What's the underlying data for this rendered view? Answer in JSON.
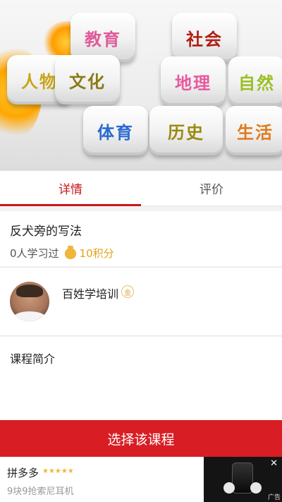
{
  "hero": {
    "tiles": [
      "教育",
      "社会",
      "人物",
      "文化",
      "地理",
      "自然",
      "体育",
      "历史",
      "生活"
    ]
  },
  "tabs": [
    {
      "label": "详情",
      "active": true
    },
    {
      "label": "评价",
      "active": false
    }
  ],
  "course": {
    "title": "反犬旁的写法",
    "learners": "0人学习过",
    "points": "10积分"
  },
  "teacher": {
    "name": "百姓学培训",
    "badge": "金"
  },
  "intro": {
    "label": "课程简介"
  },
  "cta": {
    "label": "选择该课程"
  },
  "ad": {
    "brand": "拼多多",
    "stars": "★★★★★",
    "description": "9块9抢索尼耳机",
    "close_icon": "✕",
    "tag": "广告"
  },
  "colors": {
    "accent": "#c8161d",
    "cta_bg": "#d81e24",
    "coin": "#e3a31b"
  }
}
